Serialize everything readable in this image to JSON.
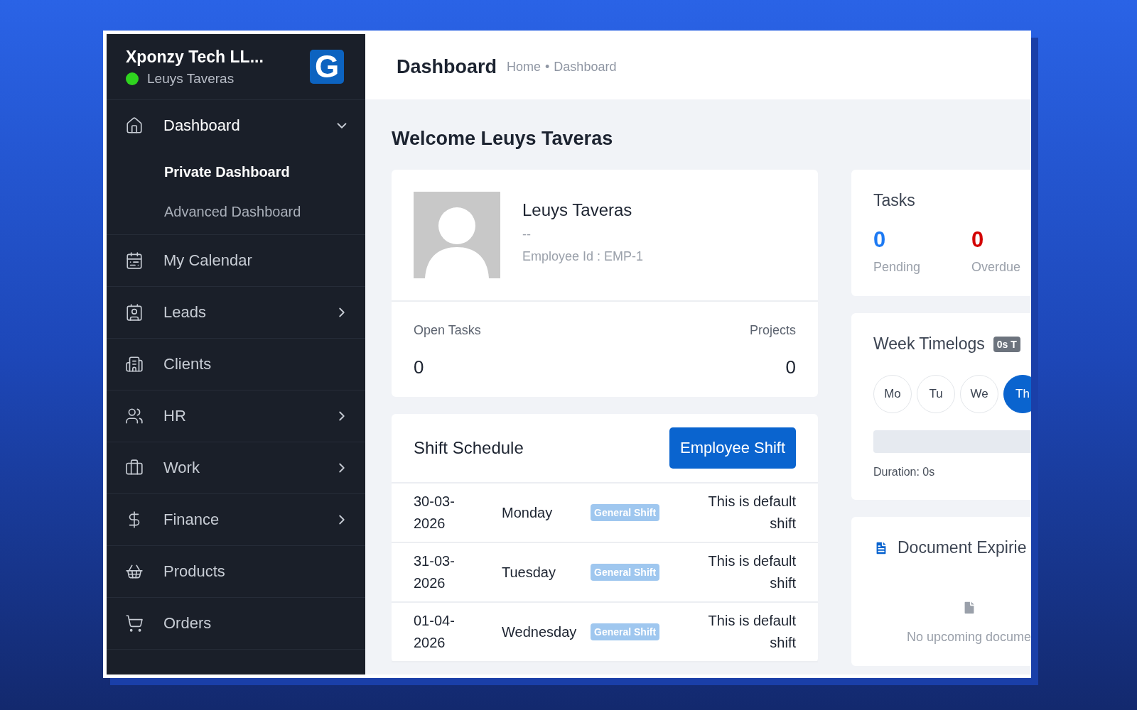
{
  "sidebar": {
    "company": "Xponzy Tech LL...",
    "user": "Leuys Taveras",
    "online": true,
    "logo_letter": "G",
    "items": [
      {
        "label": "Dashboard",
        "expandable": true,
        "expanded": true,
        "children": [
          {
            "label": "Private Dashboard",
            "selected": true
          },
          {
            "label": "Advanced Dashboard",
            "selected": false
          }
        ]
      },
      {
        "label": "My Calendar",
        "expandable": false,
        "expanded": false
      },
      {
        "label": "Leads",
        "expandable": true,
        "expanded": false
      },
      {
        "label": "Clients",
        "expandable": false,
        "expanded": false
      },
      {
        "label": "HR",
        "expandable": true,
        "expanded": false
      },
      {
        "label": "Work",
        "expandable": true,
        "expanded": false
      },
      {
        "label": "Finance",
        "expandable": true,
        "expanded": false
      },
      {
        "label": "Products",
        "expandable": false,
        "expanded": false
      },
      {
        "label": "Orders",
        "expandable": false,
        "expanded": false
      }
    ]
  },
  "header": {
    "title": "Dashboard",
    "breadcrumb": [
      "Home",
      "Dashboard"
    ],
    "separator": "•"
  },
  "welcome": "Welcome Leuys Taveras",
  "profile": {
    "name": "Leuys Taveras",
    "designation": "--",
    "employee_id": "Employee Id : EMP-1",
    "stats": [
      {
        "label": "Open Tasks",
        "value": "0"
      },
      {
        "label": "Projects",
        "value": "0"
      }
    ]
  },
  "shift_schedule": {
    "title": "Shift Schedule",
    "button": "Employee Shift",
    "rows": [
      {
        "date": "30-03-2026",
        "day": "Monday",
        "shift": "General Shift",
        "remark": "This is default shift"
      },
      {
        "date": "31-03-2026",
        "day": "Tuesday",
        "shift": "General Shift",
        "remark": "This is default shift"
      },
      {
        "date": "01-04-2026",
        "day": "Wednesday",
        "shift": "General Shift",
        "remark": "This is default shift"
      }
    ]
  },
  "tasks": {
    "title": "Tasks",
    "stats": [
      {
        "value": "0",
        "label": "Pending",
        "color": "#1d7af3"
      },
      {
        "value": "0",
        "label": "Overdue",
        "color": "#d30000"
      }
    ]
  },
  "week_timelogs": {
    "title": "Week Timelogs",
    "badge": "0s T",
    "days": [
      {
        "label": "Mo",
        "selected": false
      },
      {
        "label": "Tu",
        "selected": false
      },
      {
        "label": "We",
        "selected": false
      },
      {
        "label": "Th",
        "selected": true
      }
    ],
    "duration": "Duration: 0s"
  },
  "document_expiries": {
    "title": "Document Expirie",
    "empty": "No upcoming docume"
  }
}
